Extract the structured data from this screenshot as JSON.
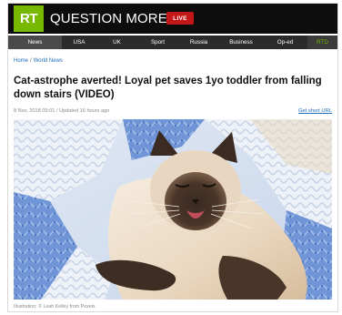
{
  "header": {
    "logo_text": "RT",
    "tagline": "QUESTION MORE",
    "live_label": "LIVE",
    "brand_color": "#77b800",
    "live_color": "#c51717"
  },
  "nav": {
    "items": [
      {
        "label": "News",
        "active": true
      },
      {
        "label": "USA"
      },
      {
        "label": "UK"
      },
      {
        "label": "Sport"
      },
      {
        "label": "Russia"
      },
      {
        "label": "Business"
      },
      {
        "label": "Op-ed"
      },
      {
        "label": "RTD"
      }
    ]
  },
  "article": {
    "breadcrumb": [
      "Home",
      "World News"
    ],
    "headline": "Cat-astrophe averted! Loyal pet saves 1yo toddler from falling down stairs (VIDEO)",
    "meta": "8 Nov, 2018 09:01 / Updated 16 hours ago",
    "short_url_label": "Get short URL",
    "image_icon": "siamese-cat-photo",
    "caption": "Illustration: © Leah Kelley from Pexels"
  }
}
